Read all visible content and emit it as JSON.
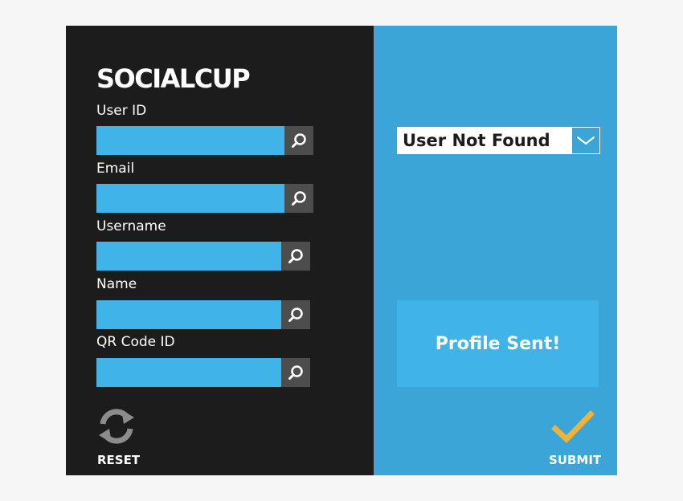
{
  "brand": {
    "title": "SOCIALCUP"
  },
  "fields": [
    {
      "label": "User ID",
      "value": "",
      "button_icon": "search-icon"
    },
    {
      "label": "Email",
      "value": "",
      "button_icon": "search-icon"
    },
    {
      "label": "Username",
      "value": "",
      "button_icon": "search-icon"
    },
    {
      "label": "Name",
      "value": "",
      "button_icon": "search-icon"
    },
    {
      "label": "QR Code ID",
      "value": "",
      "button_icon": "search-icon"
    }
  ],
  "actions": {
    "reset_label": "RESET",
    "reset_icon": "refresh-icon",
    "submit_label": "SUBMIT",
    "submit_icon": "checkmark-icon"
  },
  "lookup": {
    "selected": "User Not Found",
    "arrow_icon": "chevron-down-icon"
  },
  "status": {
    "message": "Profile Sent!"
  },
  "colors": {
    "left_panel": "#1c1c1c",
    "right_panel": "#3aa5d6",
    "input_fill": "#40b3e8",
    "search_button": "#4d4d4d",
    "check_accent": "#f2b233",
    "reset_icon": "#8c8c8c"
  }
}
